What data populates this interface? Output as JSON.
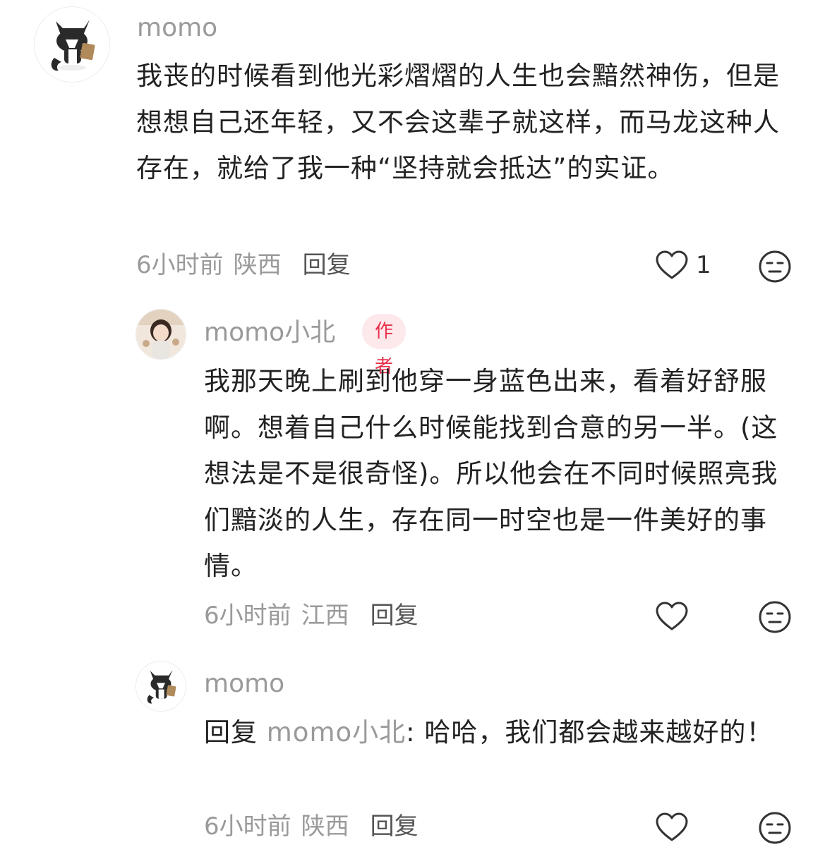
{
  "comments": [
    {
      "username": "momo",
      "content": "我丧的时候看到他光彩熠熠的人生也会黯然神伤，但是想想自己还年轻，又不会这辈子就这样，而马龙这种人存在，就给了我一种“坚持就会抵达”的实证。",
      "time": "6小时前",
      "location": "陕西",
      "reply_label": "回复",
      "like_count": "1"
    },
    {
      "username": "momo小北",
      "badge": "作者",
      "content": "我那天晚上刷到他穿一身蓝色出来，看着好舒服啊。想着自己什么时候能找到合意的另一半。(这想法是不是很奇怪)。所以他会在不同时候照亮我们黯淡的人生，存在同一时空也是一件美好的事情。",
      "time": "6小时前",
      "location": "江西",
      "reply_label": "回复"
    },
    {
      "username": "momo",
      "reply_prefix": "回复",
      "reply_to": "momo小北",
      "content": ": 哈哈，我们都会越来越好的！",
      "time": "6小时前",
      "location": "陕西",
      "reply_label": "回复"
    }
  ],
  "icons": {
    "like": "heart-outline-icon",
    "dislike": "unamused-face-icon"
  },
  "colors": {
    "text": "#222222",
    "muted": "#9a9a9a",
    "badge_bg": "#fde9ec",
    "badge_text": "#e8304a"
  }
}
